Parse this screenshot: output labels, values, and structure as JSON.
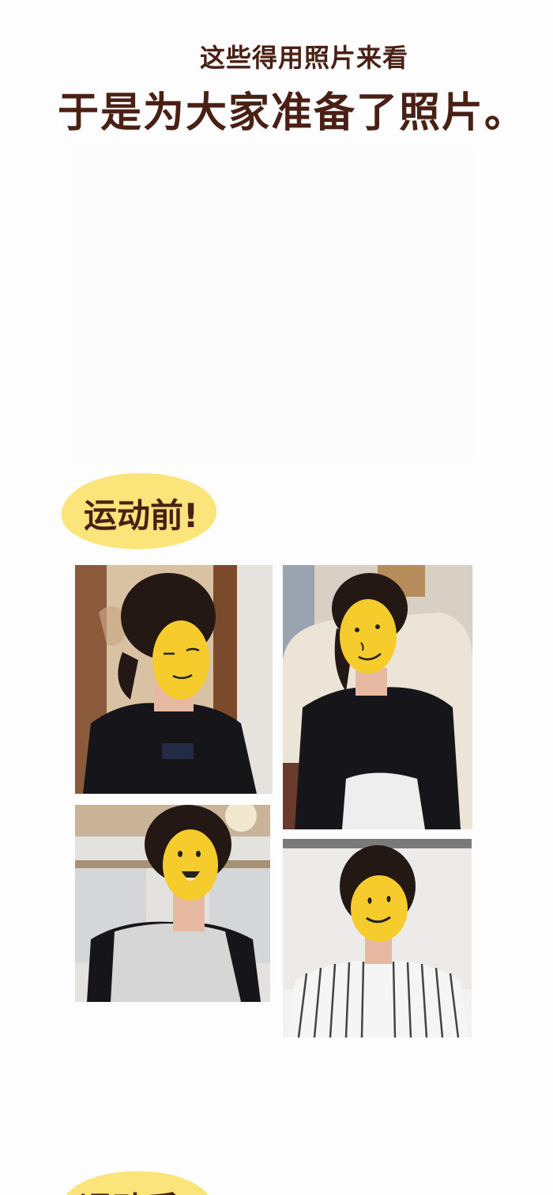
{
  "header": {
    "subtitle": "这些得用照片来看",
    "title": "于是为大家准备了照片。"
  },
  "sections": [
    {
      "label": "运动前!"
    },
    {
      "label": "运动后!"
    }
  ],
  "colors": {
    "text": "#4a1f14",
    "badge": "#fbe47a",
    "emoji_face": "#f6cc2c"
  },
  "photos": [
    {
      "icon": "face-sleepy-icon"
    },
    {
      "icon": "face-smirk-icon"
    },
    {
      "icon": "face-laughing-icon"
    },
    {
      "icon": "face-smile-icon"
    }
  ]
}
